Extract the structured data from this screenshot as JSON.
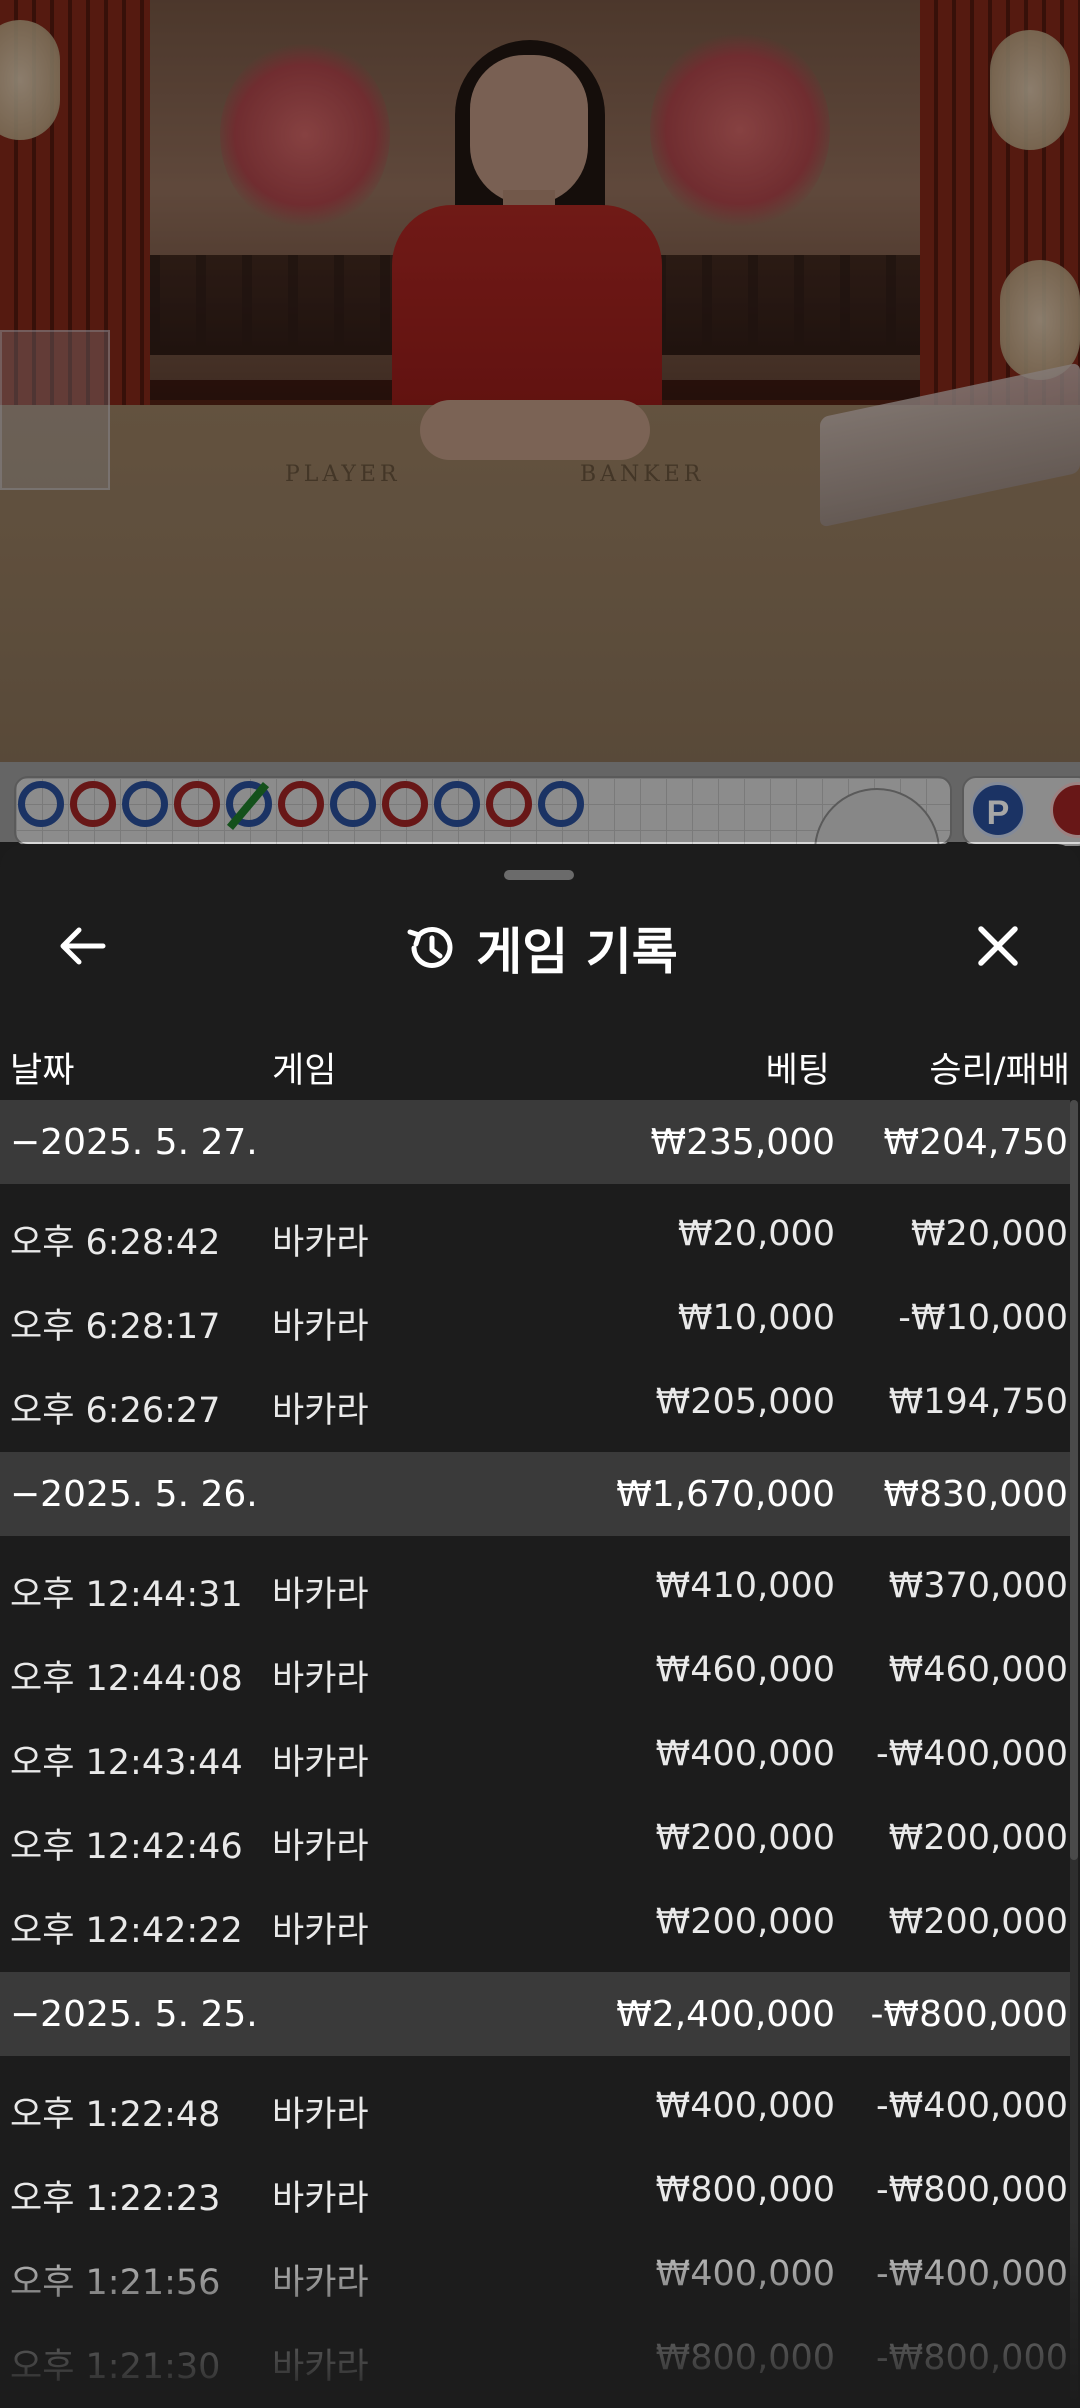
{
  "sheet": {
    "title": "게임 기록",
    "icons": {
      "back": "arrow-left-icon",
      "history": "history-icon",
      "close": "close-icon"
    }
  },
  "table_headers": {
    "date": "날짜",
    "game": "게임",
    "bet": "베팅",
    "result": "승리/패배"
  },
  "groups": [
    {
      "date": "−2025. 5. 27.",
      "bet_total": "₩235,000",
      "result_total": "₩204,750",
      "rows": [
        {
          "time": "오후 6:28:42",
          "game": "바카라",
          "bet": "₩20,000",
          "result": "₩20,000"
        },
        {
          "time": "오후 6:28:17",
          "game": "바카라",
          "bet": "₩10,000",
          "result": "-₩10,000"
        },
        {
          "time": "오후 6:26:27",
          "game": "바카라",
          "bet": "₩205,000",
          "result": "₩194,750"
        }
      ]
    },
    {
      "date": "−2025. 5. 26.",
      "bet_total": "₩1,670,000",
      "result_total": "₩830,000",
      "rows": [
        {
          "time": "오후 12:44:31",
          "game": "바카라",
          "bet": "₩410,000",
          "result": "₩370,000"
        },
        {
          "time": "오후 12:44:08",
          "game": "바카라",
          "bet": "₩460,000",
          "result": "₩460,000"
        },
        {
          "time": "오후 12:43:44",
          "game": "바카라",
          "bet": "₩400,000",
          "result": "-₩400,000"
        },
        {
          "time": "오후 12:42:46",
          "game": "바카라",
          "bet": "₩200,000",
          "result": "₩200,000"
        },
        {
          "time": "오후 12:42:22",
          "game": "바카라",
          "bet": "₩200,000",
          "result": "₩200,000"
        }
      ]
    },
    {
      "date": "−2025. 5. 25.",
      "bet_total": "₩2,400,000",
      "result_total": "-₩800,000",
      "rows": [
        {
          "time": "오후 1:22:48",
          "game": "바카라",
          "bet": "₩400,000",
          "result": "-₩400,000"
        },
        {
          "time": "오후 1:22:23",
          "game": "바카라",
          "bet": "₩800,000",
          "result": "-₩800,000"
        },
        {
          "time": "오후 1:21:56",
          "game": "바카라",
          "bet": "₩400,000",
          "result": "-₩400,000"
        },
        {
          "time": "오후 1:21:30",
          "game": "바카라",
          "bet": "₩800,000",
          "result": "-₩800,000"
        }
      ]
    }
  ],
  "video": {
    "table_labels": {
      "player": "PLAYER",
      "banker": "BANKER"
    }
  },
  "roadmap": {
    "beads": [
      "P",
      "B",
      "P",
      "B",
      "P",
      "B",
      "P",
      "B",
      "P",
      "B",
      "P"
    ],
    "badge": "P",
    "colors": {
      "player": "#2a4f9a",
      "banker": "#a02424",
      "tie": "#1f7d2a"
    }
  }
}
